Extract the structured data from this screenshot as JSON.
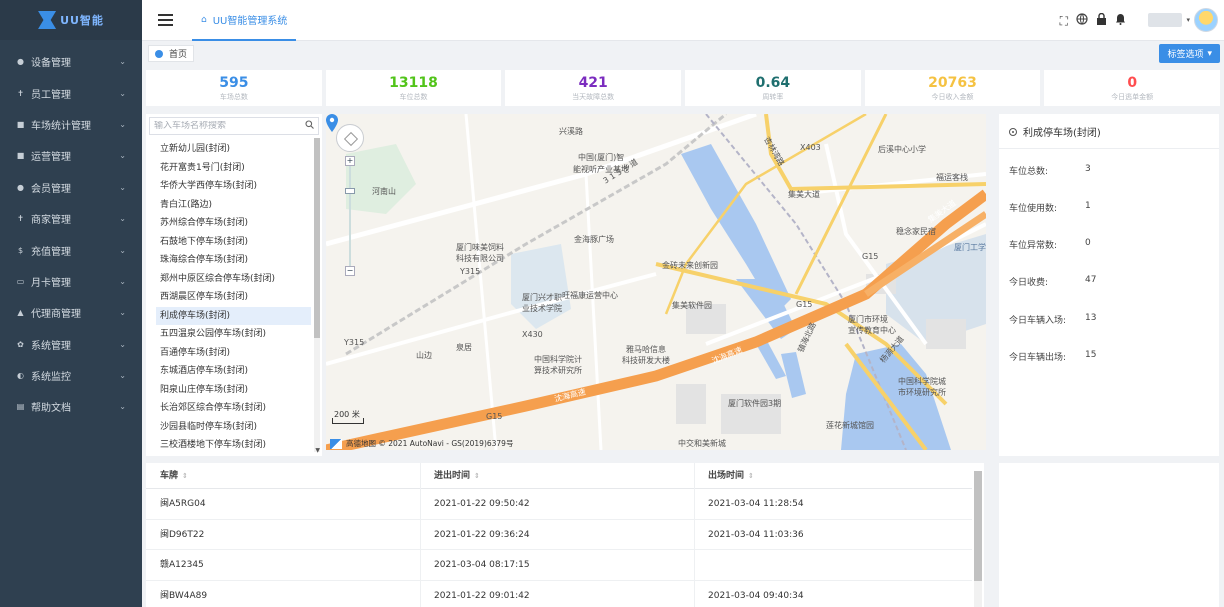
{
  "brand": {
    "name": "UU智能",
    "accent": "#3a8ee6"
  },
  "sidebar": {
    "items": [
      {
        "label": "设备管理",
        "icon": "dot-icon",
        "glyph": "●"
      },
      {
        "label": "员工管理",
        "icon": "person-icon",
        "glyph": "✝"
      },
      {
        "label": "车场统计管理",
        "icon": "parking-icon",
        "glyph": "■"
      },
      {
        "label": "运营管理",
        "icon": "grid-icon",
        "glyph": "■"
      },
      {
        "label": "会员管理",
        "icon": "member-icon",
        "glyph": "●"
      },
      {
        "label": "商家管理",
        "icon": "merchant-icon",
        "glyph": "✝"
      },
      {
        "label": "充值管理",
        "icon": "dollar-icon",
        "glyph": "$"
      },
      {
        "label": "月卡管理",
        "icon": "card-icon",
        "glyph": "▭"
      },
      {
        "label": "代理商管理",
        "icon": "graduation-icon",
        "glyph": "▲"
      },
      {
        "label": "系统管理",
        "icon": "gear-icon",
        "glyph": "✿"
      },
      {
        "label": "系统监控",
        "icon": "monitor-icon",
        "glyph": "◐"
      },
      {
        "label": "帮助文档",
        "icon": "book-icon",
        "glyph": "▤"
      }
    ]
  },
  "header": {
    "home_tab": "UU智能管理系统",
    "icons": [
      "fullscreen-icon",
      "globe-icon",
      "lock-icon",
      "bell-icon"
    ]
  },
  "tagbar": {
    "page_tag": "首页",
    "options_label": "标签选项"
  },
  "stats": [
    {
      "value": "595",
      "label": "车场总数",
      "color": "#3a8ee6"
    },
    {
      "value": "13118",
      "label": "车位总数",
      "color": "#52c41a"
    },
    {
      "value": "421",
      "label": "当天故障总数",
      "color": "#7b2cbf"
    },
    {
      "value": "0.64",
      "label": "周转率",
      "color": "#1f6f6f"
    },
    {
      "value": "20763",
      "label": "今日收入金额",
      "color": "#f5c242"
    },
    {
      "value": "0",
      "label": "今日逃单金额",
      "color": "#ff4d4f"
    }
  ],
  "park_list": {
    "search_placeholder": "输入车场名称搜索",
    "items": [
      "立新幼儿园(封闭)",
      "花开富贵1号门(封闭)",
      "华侨大学西停车场(封闭)",
      "青白江(路边)",
      "苏州综合停车场(封闭)",
      "石鼓地下停车场(封闭)",
      "珠海综合停车场(封闭)",
      "郑州中原区综合停车场(封闭)",
      "西湖晨区停车场(封闭)",
      "利成停车场(封闭)",
      "五四温泉公园停车场(封闭)",
      "百通停车场(封闭)",
      "东城酒店停车场(封闭)",
      "阳泉山庄停车场(封闭)",
      "长治郊区综合停车场(封闭)",
      "沙园县临时停车场(封闭)",
      "三校酒楼地下停车场(封闭)"
    ],
    "active_index": 9
  },
  "map": {
    "scale": "200 米",
    "copyright": "高德地图 © 2021 AutoNavi - GS(2019)6379号",
    "labels": {
      "xingjin": "兴溪路",
      "zhongguo": "中国(厦门)智",
      "zhongguo2": "能视听产业基地",
      "henan": "河南山",
      "houxi": "后溪中心小学",
      "fuyun": "福运客栈",
      "jimei": "集美大道",
      "jinhai": "金海豚广场",
      "shenghai": "沈海高速",
      "xiamen_weilai": "厦门味美饲料",
      "xiamen_weilai2": "科技有限公司",
      "jinxin": "金砖未来创新园",
      "wangfu": "旺福康运营中心",
      "jimeisoft": "集美软件园",
      "xingcai": "厦门兴才职",
      "xingcai2": "业技术学院",
      "yama": "雅马哈信息",
      "yama2": "科技研发大楼",
      "kexueyuan": "中国科学院计",
      "kexueyuan2": "算技术研究所",
      "huanjing": "厦门市环境",
      "huanjing2": "宣传教育中心",
      "kexuecheng": "中国科学院城",
      "kexuecheng2": "市环境研究所",
      "soft3": "厦门软件园3期",
      "lianhua": "莲花新城馆园",
      "zhongjiao": "中交和美新城",
      "xinghua": "杏林湾路",
      "yingkou": "镇海北路",
      "yangyong": "杨源大道",
      "minsu": "稳念家民宿",
      "xiamengong": "厦门工学",
      "jimeidadao": "集美大道",
      "shenhai2": "沈海高速",
      "tongji": "同集",
      "road_g15": "G15",
      "road_y315": "Y315",
      "road_x403": "X403",
      "road_x430": "X430",
      "road_315": "3 1 5 乡道",
      "shanjiao": "山边",
      "gongye": "泉居"
    }
  },
  "info_panel": {
    "title": "利成停车场(封闭)",
    "rows": [
      {
        "label": "车位总数:",
        "value": "3"
      },
      {
        "label": "车位使用数:",
        "value": "1"
      },
      {
        "label": "车位异常数:",
        "value": "0"
      },
      {
        "label": "今日收费:",
        "value": "47"
      },
      {
        "label": "今日车辆入场:",
        "value": "13"
      },
      {
        "label": "今日车辆出场:",
        "value": "15"
      }
    ]
  },
  "table": {
    "headers": [
      "车牌",
      "进出时间",
      "出场时间"
    ],
    "rows": [
      [
        "闽A5RG04",
        "2021-01-22 09:50:42",
        "2021-03-04 11:28:54"
      ],
      [
        "闽D96T22",
        "2021-01-22 09:36:24",
        "2021-03-04 11:03:36"
      ],
      [
        "赣A12345",
        "2021-03-04 08:17:15",
        ""
      ],
      [
        "闽BW4A89",
        "2021-01-22 09:01:42",
        "2021-03-04 09:40:34"
      ]
    ]
  }
}
